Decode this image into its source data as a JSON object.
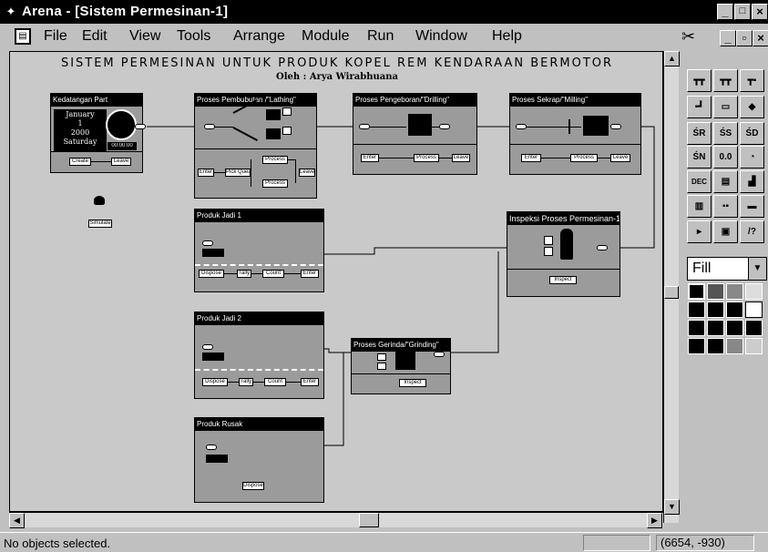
{
  "window": {
    "title": "Arena - [Sistem Permesinan-1]",
    "minimize": "_",
    "maximize": "□",
    "close": "×",
    "doc_minimize": "_",
    "doc_restore": "▫",
    "doc_close": "×"
  },
  "menu": [
    "File",
    "Edit",
    "View",
    "Tools",
    "Arrange",
    "Module",
    "Run",
    "Window",
    "Help"
  ],
  "canvas": {
    "title": "SISTEM PERMESINAN UNTUK PRODUK KOPEL REM KENDARAAN BERMOTOR",
    "subtitle": "Oleh : Arya Wirabhuana",
    "sim_block": "Simulate"
  },
  "modules": [
    {
      "id": "kedatangan",
      "title": "Kedatangan Part"
    },
    {
      "id": "pembubutan",
      "title": "Proses Pembubutan /\"Lathing\""
    },
    {
      "id": "pengeboran",
      "title": "Proses Pengeboran/\"Drilling\""
    },
    {
      "id": "sekrap",
      "title": "Proses Sekrap/\"Milling\""
    },
    {
      "id": "jadi1",
      "title": "Produk Jadi 1"
    },
    {
      "id": "inspeksi",
      "title": "Inspeksi Proses Permesinan-1"
    },
    {
      "id": "jadi2",
      "title": "Produk Jadi 2"
    },
    {
      "id": "gerinda",
      "title": "Proses Gerinda/\"Grinding\""
    },
    {
      "id": "rusak",
      "title": "Produk Rusak"
    }
  ],
  "calendar": {
    "month": "January",
    "day": "1",
    "year": "2000",
    "weekday": "Saturday",
    "time": "00:00:00"
  },
  "blocks": {
    "create": "Create",
    "leave": "Leave",
    "enter": "Enter",
    "pick_queue": "Pick Queue",
    "process": "Process",
    "dispose": "Dispose",
    "tally": "Tally",
    "count": "Count",
    "inspect": "Inspect"
  },
  "status": {
    "text": "No objects selected.",
    "coords": "(6654, -930)"
  },
  "tools": [
    [
      "┳┳",
      "┳┳",
      "┳▪"
    ],
    [
      "▪┛",
      "▭",
      "◆"
    ],
    [
      "ŚR",
      "ŚS",
      "ŚD"
    ],
    [
      "ŚN",
      "0.0",
      "◔"
    ],
    [
      "DEC",
      "▤",
      "▟"
    ],
    [
      "▥",
      "▪▪",
      "▬"
    ],
    [
      "▸",
      "▣",
      "/?"
    ]
  ],
  "fill": {
    "label": "Fill",
    "arrow": "▼"
  },
  "scroll": {
    "up": "▲",
    "down": "▼",
    "left": "◀",
    "right": "▶"
  },
  "colors": {
    "titlebar": "#000000",
    "module_body": "#9b9b9b",
    "canvas": "#c9c9c9"
  }
}
